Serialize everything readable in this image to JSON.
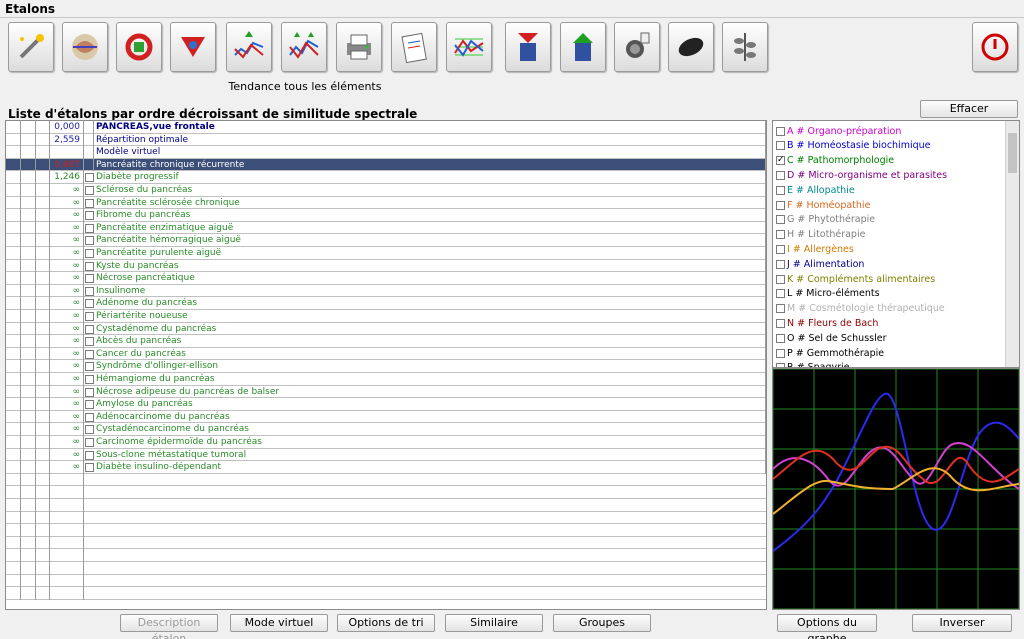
{
  "window": {
    "title": "Etalons"
  },
  "toolbar": {
    "buttons": [
      {
        "name": "magic-wand-button",
        "icon": "magic-wand-icon"
      },
      {
        "name": "brain-view-button",
        "icon": "brain-icon"
      },
      {
        "name": "red-cycle-button",
        "icon": "red-cycle-icon"
      },
      {
        "name": "red-arrows-button",
        "icon": "red-arrows-icon"
      },
      {
        "name": "trend-up-button",
        "icon": "trend-up-icon"
      },
      {
        "name": "trend-all-button",
        "icon": "trend-all-icon"
      },
      {
        "name": "print-button",
        "icon": "printer-icon"
      },
      {
        "name": "notepad-button",
        "icon": "notepad-icon"
      },
      {
        "name": "spectrum-button",
        "icon": "spectrum-icon"
      },
      {
        "name": "down-container-button",
        "icon": "down-container-icon"
      },
      {
        "name": "up-container-button",
        "icon": "up-container-icon"
      },
      {
        "name": "microbe-button",
        "icon": "microbe-icon"
      },
      {
        "name": "capsule-button",
        "icon": "capsule-icon"
      },
      {
        "name": "plant-button",
        "icon": "plant-icon"
      }
    ],
    "caption": "Tendance tous les éléments",
    "power_icon": "power-icon"
  },
  "list": {
    "title": "Liste d'étalons par ordre décroissant de similitude spectrale",
    "rows": [
      {
        "score": "0,000",
        "name": "PANCREAS,vue frontale",
        "kind": "header",
        "checkbox": false
      },
      {
        "score": "2,559",
        "name": "Répartition optimale",
        "kind": "header2",
        "checkbox": false
      },
      {
        "score": "",
        "name": "Modèle virtuel",
        "kind": "plain",
        "checkbox": false
      },
      {
        "score": "0,687",
        "name": "Pancréatite chronique récurrente",
        "kind": "selected",
        "checkbox": false
      },
      {
        "score": "1,246",
        "name": "Diabète progressif",
        "kind": "item",
        "checkbox": true
      },
      {
        "score": "∞",
        "name": "Sclérose du pancréas",
        "kind": "item",
        "checkbox": true
      },
      {
        "score": "∞",
        "name": "Pancréatite sclérosée chronique",
        "kind": "item",
        "checkbox": true
      },
      {
        "score": "∞",
        "name": "Fibrome du pancréas",
        "kind": "item",
        "checkbox": true
      },
      {
        "score": "∞",
        "name": "Pancréatite enzimatique aiguë",
        "kind": "item",
        "checkbox": true
      },
      {
        "score": "∞",
        "name": "Pancréatite hémorragique aiguë",
        "kind": "item",
        "checkbox": true
      },
      {
        "score": "∞",
        "name": "Pancréatite purulente aiguë",
        "kind": "item",
        "checkbox": true
      },
      {
        "score": "∞",
        "name": "Kyste du pancréas",
        "kind": "item",
        "checkbox": true
      },
      {
        "score": "∞",
        "name": "Nécrose pancréatique",
        "kind": "item",
        "checkbox": true
      },
      {
        "score": "∞",
        "name": "Insulinome",
        "kind": "item",
        "checkbox": true
      },
      {
        "score": "∞",
        "name": "Adénome du pancréas",
        "kind": "item",
        "checkbox": true
      },
      {
        "score": "∞",
        "name": "Périartérite noueuse",
        "kind": "item",
        "checkbox": true
      },
      {
        "score": "∞",
        "name": "Cystadénome du pancréas",
        "kind": "item",
        "checkbox": true
      },
      {
        "score": "∞",
        "name": "Abcès du pancréas",
        "kind": "item",
        "checkbox": true
      },
      {
        "score": "∞",
        "name": "Cancer du pancréas",
        "kind": "item",
        "checkbox": true
      },
      {
        "score": "∞",
        "name": "Syndrôme d'ollinger-ellison",
        "kind": "item",
        "checkbox": true
      },
      {
        "score": "∞",
        "name": "Hémangiome du pancréas",
        "kind": "item",
        "checkbox": true
      },
      {
        "score": "∞",
        "name": "Nécrose adipeuse du pancréas de balser",
        "kind": "item",
        "checkbox": true
      },
      {
        "score": "∞",
        "name": "Amylose du pancréas",
        "kind": "item",
        "checkbox": true
      },
      {
        "score": "∞",
        "name": "Adénocarcinome du pancréas",
        "kind": "item",
        "checkbox": true
      },
      {
        "score": "∞",
        "name": "Cystadénocarcinome du pancréas",
        "kind": "item",
        "checkbox": true
      },
      {
        "score": "∞",
        "name": "Carcinome épidermoïde du pancréas",
        "kind": "item",
        "checkbox": true
      },
      {
        "score": "∞",
        "name": "Sous-clone métastatique tumoral",
        "kind": "item",
        "checkbox": true
      },
      {
        "score": "∞",
        "name": "Diabète insulino-dépendant",
        "kind": "item",
        "checkbox": true
      }
    ]
  },
  "buttons": {
    "effacer": "Effacer",
    "description": "Description étalon",
    "mode_virtuel": "Mode virtuel",
    "options_tri": "Options de tri",
    "similaire": "Similaire",
    "groupes": "Groupes",
    "options_graphe": "Options du graphe",
    "inverser": "Inverser"
  },
  "categories": [
    {
      "label": "A # Organo-préparation",
      "color": "#cc00cc",
      "checked": false
    },
    {
      "label": "B # Homéostasie biochimique",
      "color": "#0000cc",
      "checked": false
    },
    {
      "label": "C # Pathomorphologie",
      "color": "#008000",
      "checked": true
    },
    {
      "label": "D # Micro-organisme et parasites",
      "color": "#800080",
      "checked": false
    },
    {
      "label": "E # Allopathie",
      "color": "#008b8b",
      "checked": false
    },
    {
      "label": "F # Homéopathie",
      "color": "#d2691e",
      "checked": false
    },
    {
      "label": "G # Phytothérapie",
      "color": "#808080",
      "checked": false
    },
    {
      "label": "H # Litothérapie",
      "color": "#808080",
      "checked": false
    },
    {
      "label": "I # Allergènes",
      "color": "#cc7a00",
      "checked": false
    },
    {
      "label": "J # Alimentation",
      "color": "#00008b",
      "checked": false
    },
    {
      "label": "K # Compléments alimentaires",
      "color": "#808000",
      "checked": false
    },
    {
      "label": "L # Micro-éléments",
      "color": "#000000",
      "checked": false
    },
    {
      "label": "M # Cosmétologie thérapeutique",
      "color": "#b0b0b0",
      "checked": false
    },
    {
      "label": "N # Fleurs de Bach",
      "color": "#8b0000",
      "checked": false
    },
    {
      "label": "O # Sel de Schussler",
      "color": "#000000",
      "checked": false
    },
    {
      "label": "P # Gemmothérapie",
      "color": "#000000",
      "checked": false
    },
    {
      "label": "R # Spagyrie",
      "color": "#000000",
      "checked": false
    }
  ],
  "graph": {
    "background": "#000000",
    "grid_color": "#1f8a1f",
    "series_colors": [
      "#2a2af0",
      "#d040d0",
      "#e03020",
      "#f0b030"
    ]
  }
}
